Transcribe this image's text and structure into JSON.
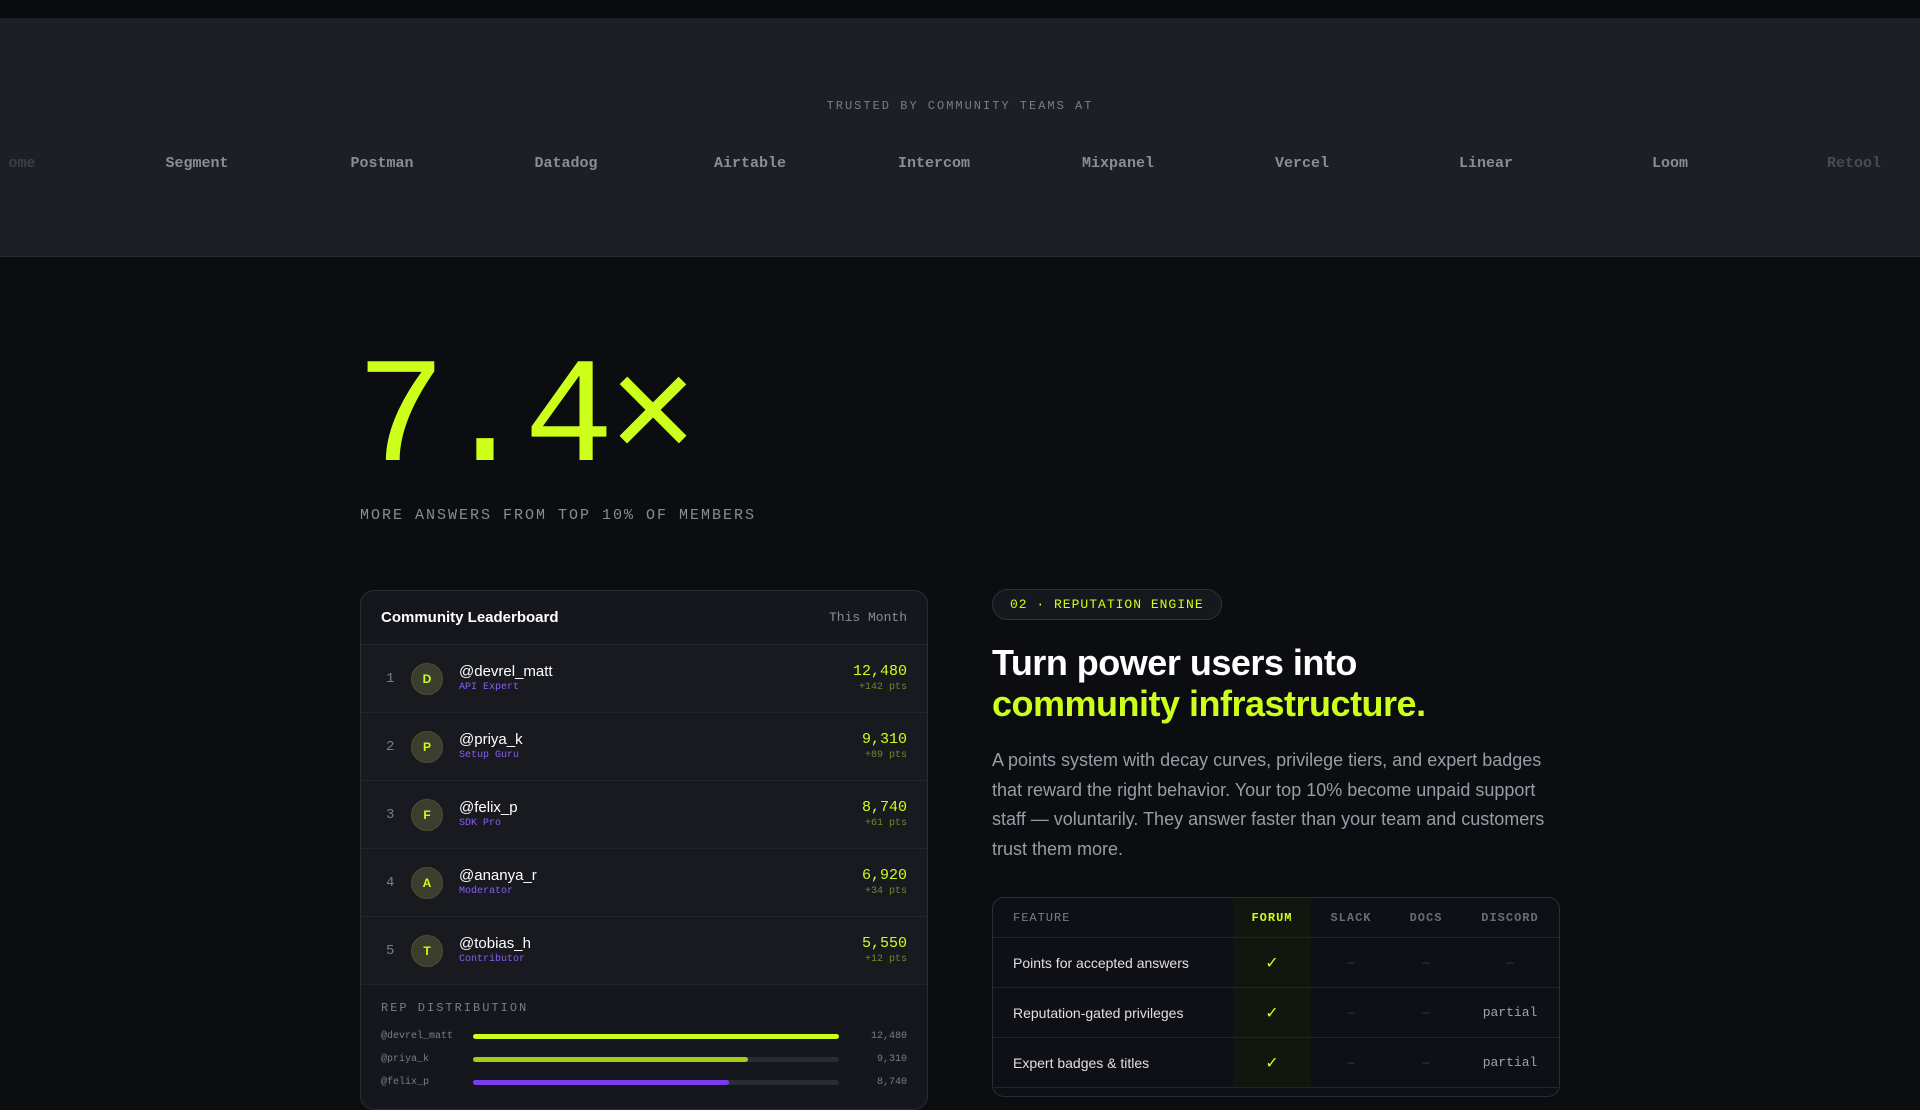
{
  "logos": {
    "caption": "TRUSTED BY COMMUNITY TEAMS AT",
    "items": [
      "ome",
      "Segment",
      "Postman",
      "Datadog",
      "Airtable",
      "Intercom",
      "Mixpanel",
      "Vercel",
      "Linear",
      "Loom",
      "Retool"
    ]
  },
  "stat": {
    "value": "7.4×",
    "caption": "MORE ANSWERS FROM TOP 10% OF MEMBERS"
  },
  "leaderboard": {
    "title": "Community Leaderboard",
    "period": "This Month",
    "rows": [
      {
        "rank": "1",
        "initial": "D",
        "name": "@devrel_matt",
        "role": "API Expert",
        "score": "12,480",
        "delta": "+142 pts"
      },
      {
        "rank": "2",
        "initial": "P",
        "name": "@priya_k",
        "role": "Setup Guru",
        "score": "9,310",
        "delta": "+89 pts"
      },
      {
        "rank": "3",
        "initial": "F",
        "name": "@felix_p",
        "role": "SDK Pro",
        "score": "8,740",
        "delta": "+61 pts"
      },
      {
        "rank": "4",
        "initial": "A",
        "name": "@ananya_r",
        "role": "Moderator",
        "score": "6,920",
        "delta": "+34 pts"
      },
      {
        "rank": "5",
        "initial": "T",
        "name": "@tobias_h",
        "role": "Contributor",
        "score": "5,550",
        "delta": "+12 pts"
      }
    ],
    "distribution": {
      "title": "REP DISTRIBUTION",
      "bars": [
        {
          "label": "@devrel_matt",
          "value": "12,480",
          "fraction": 1.0,
          "color": "#ccff1a"
        },
        {
          "label": "@priya_k",
          "value": "9,310",
          "fraction": 0.75,
          "color": "#a3cc15"
        },
        {
          "label": "@felix_p",
          "value": "8,740",
          "fraction": 0.7,
          "color": "#7c3aed"
        }
      ]
    }
  },
  "feature": {
    "pill": "02 · REPUTATION ENGINE",
    "headline_line1": "Turn power users into",
    "headline_line2": "community infrastructure.",
    "body": "A points system with decay curves, privilege tiers, and expert badges that reward the right behavior. Your top 10% become unpaid support staff — voluntarily. They answer faster than your team and customers trust them more."
  },
  "comparison": {
    "headers": [
      "FEATURE",
      "FORUM",
      "SLACK",
      "DOCS",
      "DISCORD"
    ],
    "rows": [
      {
        "feature": "Points for accepted answers",
        "forum": "✓",
        "slack": "—",
        "docs": "—",
        "discord": "—"
      },
      {
        "feature": "Reputation-gated privileges",
        "forum": "✓",
        "slack": "—",
        "docs": "—",
        "discord": "partial"
      },
      {
        "feature": "Expert badges & titles",
        "forum": "✓",
        "slack": "—",
        "docs": "—",
        "discord": "partial"
      }
    ]
  },
  "colors": {
    "accent": "#ccff1a",
    "role": "#8b5cf6",
    "background": "#0c0d11"
  }
}
